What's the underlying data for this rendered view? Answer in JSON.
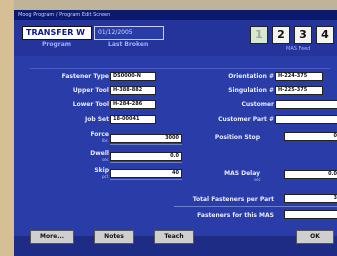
{
  "titlebar": "Moog Program / Program Edit Screen",
  "header": {
    "program_value": "TRANSFER W",
    "program_label": "Program",
    "last_broken_value": "01/12/2005",
    "last_broken_label": "Last Broken",
    "mas_buttons": [
      "1",
      "2",
      "3",
      "4"
    ],
    "mas_feed_label": "MAS Feed"
  },
  "form": {
    "fastener_type": {
      "label": "Fastener Type",
      "value": "DS0000-N"
    },
    "upper_tool": {
      "label": "Upper Tool",
      "value": "H-388-882"
    },
    "lower_tool": {
      "label": "Lower Tool",
      "value": "H-284-286"
    },
    "job_set": {
      "label": "Job Set",
      "value": "18-00041"
    },
    "force": {
      "label": "Force",
      "unit": "lbs",
      "value": "3000"
    },
    "dwell": {
      "label": "Dwell",
      "unit": "sec",
      "value": "0.0"
    },
    "skip": {
      "label": "Skip",
      "unit": "pct",
      "value": "40"
    },
    "orientation": {
      "label": "Orientation #",
      "value": "H-224-375"
    },
    "singulation": {
      "label": "Singulation #",
      "value": "H-225-375"
    },
    "customer": {
      "label": "Customer",
      "value": ""
    },
    "customer_part": {
      "label": "Customer Part #",
      "value": ""
    },
    "position_stop": {
      "label": "Position Stop",
      "value": "0"
    },
    "mas_delay": {
      "label": "MAS Delay",
      "unit": "sec",
      "value": "0.0"
    },
    "total_fasteners": {
      "label": "Total Fasteners per Part",
      "value": "3"
    },
    "fasteners_mas": {
      "label": "Fasteners for this MAS",
      "value": ""
    }
  },
  "buttons": {
    "more": "More...",
    "notes": "Notes",
    "teach": "Teach",
    "ok": "OK"
  },
  "colors": {
    "screen_bg": "#2a3ca8",
    "bezel": "#d8c39a"
  }
}
